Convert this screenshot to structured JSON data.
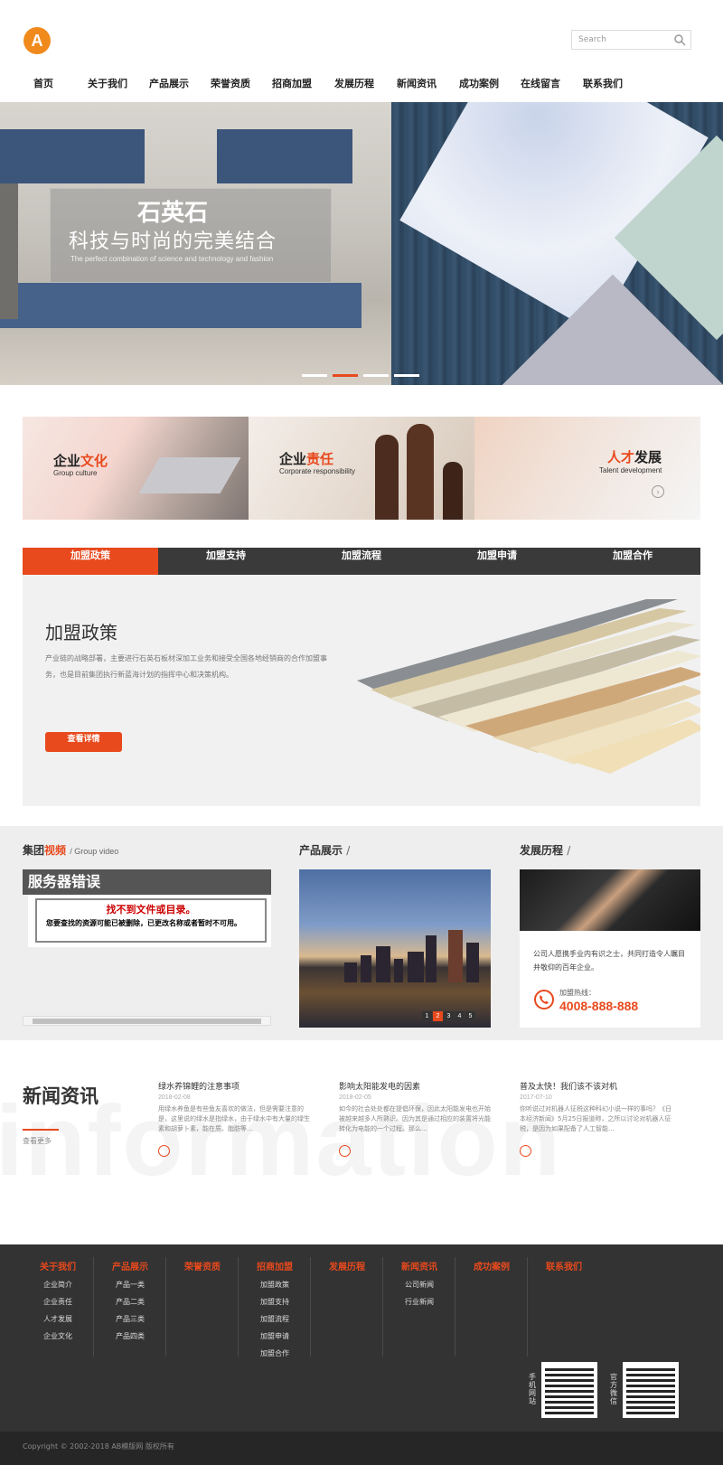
{
  "header": {
    "logo_letter": "A",
    "search_placeholder": "Search",
    "nav": [
      "首页",
      "关于我们",
      "产品展示",
      "荣誉资质",
      "招商加盟",
      "发展历程",
      "新闻资讯",
      "成功案例",
      "在线留言",
      "联系我们"
    ]
  },
  "banner": {
    "title": "石英石",
    "subtitle": "科技与时尚的完美结合",
    "subtitle_en": "The perfect combination of science and technology and fashion",
    "active_slide": 2,
    "slide_count": 4
  },
  "features": [
    {
      "title_a": "企业",
      "title_b": "文化",
      "sub": "Group culture"
    },
    {
      "title_a": "企业",
      "title_b": "责任",
      "sub": "Corporate responsibility"
    },
    {
      "title_a": "人才",
      "title_b": "发展",
      "sub": "Talent development"
    }
  ],
  "franchise": {
    "tabs": [
      "加盟政策",
      "加盟支持",
      "加盟流程",
      "加盟申请",
      "加盟合作"
    ],
    "active_tab": 0,
    "title": "加盟政策",
    "text": "产业链的战略部署，主要进行石英石板材深加工业务和接受全国各地经销商的合作加盟事务，也是目前集团执行新蓝海计划的指挥中心和决策机构。",
    "button": "查看详情"
  },
  "video": {
    "title_a": "集团",
    "title_b": "视频",
    "title_en": "/ Group video",
    "error_head": "服务器错误",
    "error_title": "找不到文件或目录。",
    "error_text": "您要查找的资源可能已被删除，已更改名称或者暂时不可用。"
  },
  "products": {
    "title": "产品展示",
    "title_suffix": "/",
    "pages": [
      "1",
      "2",
      "3",
      "4",
      "5"
    ],
    "active_page": 1
  },
  "history": {
    "title": "发展历程",
    "title_suffix": "/",
    "text": "公司人愿携手业内有识之士，共同打造令人瞩目并敬仰的百年企业。",
    "hotline_label": "加盟热线：",
    "hotline": "4008-888-888"
  },
  "news": {
    "title": "新闻资讯",
    "more": "查看更多",
    "bg_word": "information",
    "items": [
      {
        "title": "绿水养锦鲤的注意事项",
        "date": "2018-02-08",
        "text": "用绿水养鱼是有些鱼友喜欢的做法，但是需要注意的是，这里说的绿水是指绿水，由于绿水中有大量的绿生素和胡萝卜素，能在质、脂肪等..."
      },
      {
        "title": "影响太阳能发电的因素",
        "date": "2018-02-05",
        "text": "如今的社会处处都在提倡环保，因此太阳能发电也开始被越来越多人所熟识。因为其是通过相应的装置将光能转化为电能的一个过程。那么..."
      },
      {
        "title": "普及太快！我们该不该对机",
        "date": "2017-07-10",
        "text": "你听说过对机器人征税这种科幻小说一样的事吗？《日本经济新闻》5月25日报道称，之所以讨论对机器人征税，是因为如果配备了人工智能..."
      }
    ]
  },
  "footer": {
    "columns": [
      {
        "head": "关于我们",
        "links": [
          "企业简介",
          "企业责任",
          "人才发展",
          "企业文化"
        ]
      },
      {
        "head": "产品展示",
        "links": [
          "产品一类",
          "产品二类",
          "产品三类",
          "产品四类"
        ]
      },
      {
        "head": "荣誉资质",
        "links": []
      },
      {
        "head": "招商加盟",
        "links": [
          "加盟政策",
          "加盟支持",
          "加盟流程",
          "加盟申请",
          "加盟合作"
        ]
      },
      {
        "head": "发展历程",
        "links": []
      },
      {
        "head": "新闻资讯",
        "links": [
          "公司新闻",
          "行业新闻"
        ]
      },
      {
        "head": "成功案例",
        "links": []
      },
      {
        "head": "联系我们",
        "links": []
      }
    ],
    "qr_mobile_label": "手机网站",
    "qr_wechat_label": "官方微信",
    "copyright": "Copyright © 2002-2018 AB模版网 版权所有"
  },
  "colors": {
    "accent": "#e8491d",
    "logo": "#f08a1c",
    "dark": "#3a3a3a",
    "footer": "#333333"
  }
}
